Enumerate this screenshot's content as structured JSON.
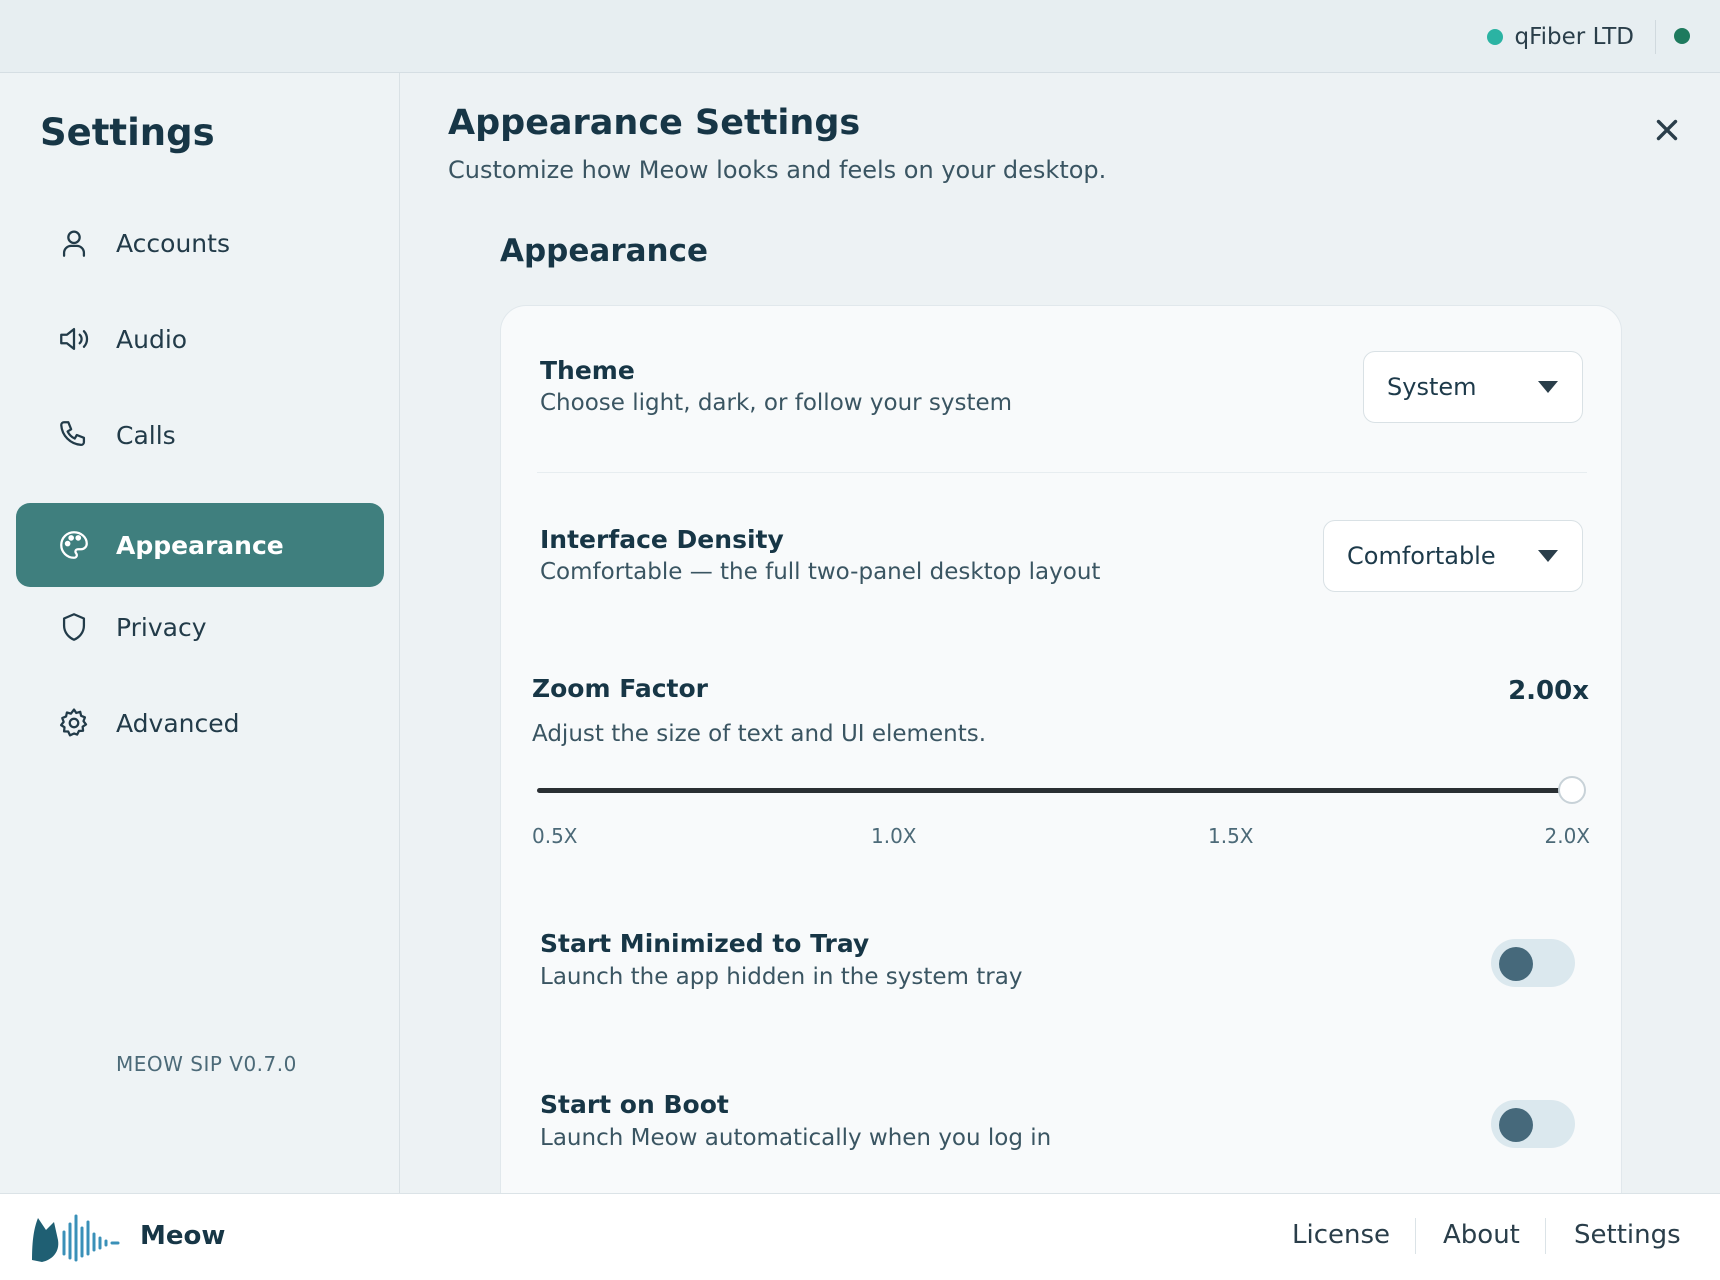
{
  "header": {
    "org_name": "qFiber LTD",
    "org_dot_color": "#2bb3a3",
    "status_color": "#1e7a5e"
  },
  "sidebar": {
    "title": "Settings",
    "items": [
      {
        "label": "Accounts",
        "icon": "user-icon",
        "active": false
      },
      {
        "label": "Audio",
        "icon": "speaker-icon",
        "active": false
      },
      {
        "label": "Calls",
        "icon": "phone-icon",
        "active": false
      },
      {
        "label": "Appearance",
        "icon": "palette-icon",
        "active": true
      },
      {
        "label": "Privacy",
        "icon": "shield-icon",
        "active": false
      },
      {
        "label": "Advanced",
        "icon": "gear-icon",
        "active": false
      }
    ],
    "version": "MEOW SIP V0.7.0",
    "active_color": "#3f7f7e"
  },
  "main": {
    "title": "Appearance Settings",
    "subtitle": "Customize how Meow looks and feels on your desktop.",
    "close_icon": "close-icon",
    "section_title": "Appearance",
    "theme": {
      "title": "Theme",
      "description": "Choose light, dark, or follow your system",
      "value": "System"
    },
    "density": {
      "title": "Interface Density",
      "description": "Comfortable — the full two-panel desktop layout",
      "value": "Comfortable"
    },
    "zoom": {
      "title": "Zoom Factor",
      "description": "Adjust the size of text and UI elements.",
      "value_label": "2.00x",
      "value": 2.0,
      "min": 0.5,
      "max": 2.0,
      "ticks": [
        "0.5X",
        "1.0X",
        "1.5X",
        "2.0X"
      ]
    },
    "start_minimized": {
      "title": "Start Minimized to Tray",
      "description": "Launch the app hidden in the system tray",
      "enabled": false
    },
    "start_on_boot": {
      "title": "Start on Boot",
      "description": "Launch Meow automatically when you log in",
      "enabled": false
    }
  },
  "footer": {
    "brand": "Meow",
    "links": [
      "License",
      "About",
      "Settings"
    ]
  }
}
